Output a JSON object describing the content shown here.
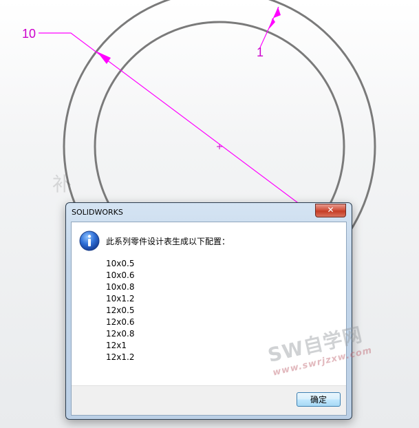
{
  "drawing": {
    "dimension_diameter": "10",
    "dimension_thickness": "1",
    "side_watermark": "补"
  },
  "dialog": {
    "title": "SOLIDWORKS",
    "close_label": "✕",
    "message": "此系列零件设计表生成以下配置：",
    "configurations": [
      "10x0.5",
      "10x0.6",
      "10x0.8",
      "10x1.2",
      "12x0.5",
      "12x0.6",
      "12x0.8",
      "12x1",
      "12x1.2"
    ],
    "ok_label": "确定",
    "icon": "info-icon"
  },
  "watermark": {
    "main": "SW自学网",
    "url": "www.swrjzxw.com"
  },
  "colors": {
    "dimension": "#cc00cc",
    "circle": "#7a7a7a"
  }
}
